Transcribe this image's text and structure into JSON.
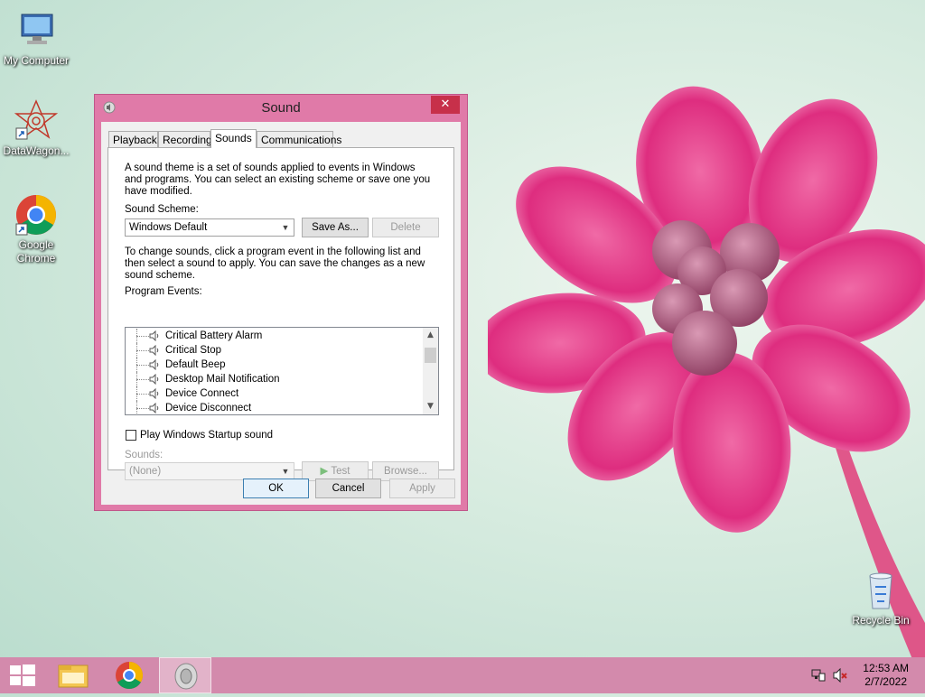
{
  "desktop": {
    "icons": [
      {
        "label": "My Computer",
        "icon": "computer-icon"
      },
      {
        "label": "DataWagon...",
        "icon": "datawagon-app-icon"
      },
      {
        "label": "Google Chrome",
        "icon": "chrome-icon"
      },
      {
        "label": "Recycle Bin",
        "icon": "recycle-bin-icon"
      }
    ]
  },
  "dialog": {
    "title": "Sound",
    "close_glyph": "✕",
    "tabs": [
      "Playback",
      "Recording",
      "Sounds",
      "Communications"
    ],
    "active_tab": "Sounds",
    "intro_text_lines": [
      "A sound theme is a set of sounds applied to events in Windows",
      "and programs.  You can select an existing scheme or save one you",
      "have modified."
    ],
    "scheme_label": "Sound Scheme:",
    "scheme_value": "Windows Default",
    "save_as_label": "Save As...",
    "delete_label": "Delete",
    "change_text_lines": [
      "To change sounds, click a program event in the following list and",
      "then select a sound to apply.  You can save the changes as a new",
      "sound scheme."
    ],
    "events_label": "Program Events:",
    "events": [
      "Critical Battery Alarm",
      "Critical Stop",
      "Default Beep",
      "Desktop Mail Notification",
      "Device Connect",
      "Device Disconnect"
    ],
    "startup_checkbox_label": "Play Windows Startup sound",
    "startup_checked": false,
    "sounds_label": "Sounds:",
    "sounds_value": "(None)",
    "test_label": "Test",
    "browse_label": "Browse...",
    "ok_label": "OK",
    "cancel_label": "Cancel",
    "apply_label": "Apply"
  },
  "taskbar": {
    "items": [
      "start-button",
      "file-explorer",
      "chrome",
      "sound-control-panel"
    ],
    "clock_time": "12:53 AM",
    "clock_date": "2/7/2022",
    "accent": "#d38aac"
  }
}
